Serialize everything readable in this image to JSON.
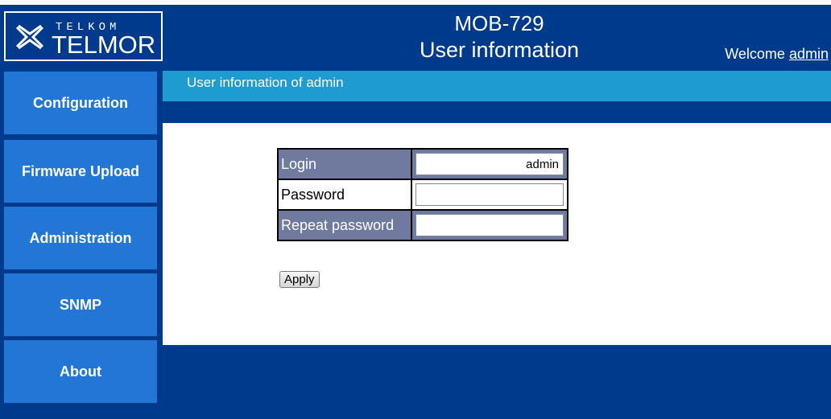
{
  "brand": {
    "logo_top": "TELKOM",
    "logo_main": "TELMOR"
  },
  "header": {
    "title_line1": "MOB-729",
    "title_line2": "User information"
  },
  "welcome": {
    "prefix": "Welcome",
    "user": "admin"
  },
  "sidebar": {
    "items": [
      {
        "label": "Configuration"
      },
      {
        "label": "Firmware Upload"
      },
      {
        "label": "Administration"
      },
      {
        "label": "SNMP"
      },
      {
        "label": "About"
      }
    ]
  },
  "section": {
    "heading": "User information of admin"
  },
  "form": {
    "login": {
      "label": "Login",
      "value": "admin"
    },
    "password": {
      "label": "Password",
      "value": ""
    },
    "repeat_password": {
      "label": "Repeat password",
      "value": ""
    },
    "apply_label": "Apply"
  },
  "colors": {
    "frame": "#003a8c",
    "sidebar_item": "#2277d6",
    "section_bar": "#1e9bd1",
    "row_shade": "#707a9e"
  }
}
